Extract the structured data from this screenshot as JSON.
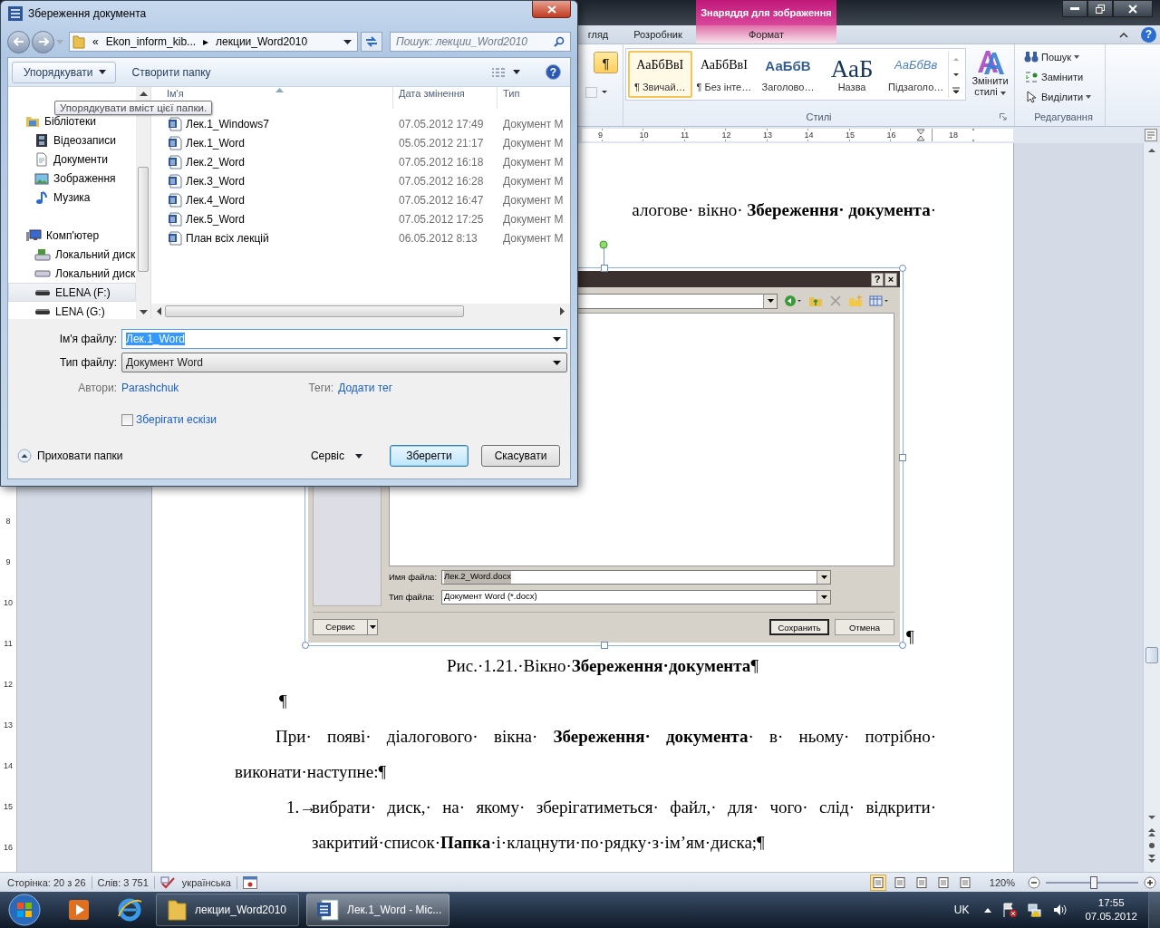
{
  "word": {
    "contextual_tab_group": "Знаряддя для зображення",
    "tabs": [
      {
        "label": "гляд",
        "selected": false,
        "contextual": false
      },
      {
        "label": "Розробник",
        "selected": false,
        "contextual": false
      },
      {
        "label": "Формат",
        "selected": false,
        "contextual": true
      }
    ],
    "ribbon": {
      "show_marks": {
        "label": "¶",
        "on": true
      },
      "styles": [
        {
          "sample": "АаБбВвІ",
          "name": "¶ Звичай…",
          "kind": "normal",
          "selected": true
        },
        {
          "sample": "АаБбВвІ",
          "name": "¶ Без інте…",
          "kind": "normal",
          "selected": false
        },
        {
          "sample": "АаБбВ",
          "name": "Заголово…",
          "kind": "heading",
          "selected": false
        },
        {
          "sample": "АаБ",
          "name": "Назва",
          "kind": "title",
          "selected": false
        },
        {
          "sample": "АаБбВв",
          "name": "Підзаголо…",
          "kind": "subtitle",
          "selected": false
        }
      ],
      "change_styles": "Змінити стилі",
      "styles_group": "Стилі",
      "editing": [
        {
          "label": "Пошук",
          "dropdown": true
        },
        {
          "label": "Замінити",
          "dropdown": false
        },
        {
          "label": "Виділити",
          "dropdown": true
        }
      ],
      "editing_group": "Редагування"
    },
    "help": "?",
    "ruler": {
      "numbers": [
        "9",
        "10",
        "11",
        "12",
        "13",
        "14",
        "15",
        "16"
      ],
      "after_marker": [
        "18"
      ]
    },
    "vertical_ruler": [
      "8",
      "9",
      "10",
      "11",
      "12",
      "13",
      "14",
      "15",
      "16"
    ],
    "document": {
      "first_line": "алогове· вікно· **Збереження· документа**·",
      "picture": {
        "file_name": {
          "label": "Имя файла:",
          "value": "Лек.2_Word.docx"
        },
        "file_type": {
          "label": "Тип файла:",
          "value": "Документ Word (*.docx)"
        },
        "title_buttons": [
          "?",
          "×"
        ],
        "tools": "Сервис",
        "buttons": [
          {
            "label": "Сохранить",
            "default": true
          },
          {
            "label": "Отмена",
            "default": false
          }
        ]
      },
      "picture_mark": "¶",
      "caption": "Рис.·1.21.·Вікно·**Збереження·документа**¶",
      "empty_paragraph": "¶",
      "paragraph": "При· появі· діалогового· вікна· **Збереження· документа**· в· ньому· потрібно· виконати·наступне:¶",
      "list": [
        {
          "number": "1.→",
          "text": "вибрати· диск,· на· якому· зберігатиметься· файл,· для· чого· слід· відкрити· закритий·список·**Папка**·і·клацнути·по·рядку·з·ім’ям·диска;¶"
        }
      ]
    },
    "status_bar": {
      "page": "Сторінка: 20 з 26",
      "words": "Слів: 3 751",
      "language": "українська",
      "views": [
        {
          "selected": true
        },
        {
          "selected": false
        },
        {
          "selected": false
        },
        {
          "selected": false
        },
        {
          "selected": false
        }
      ],
      "zoom": "120%",
      "zoom_slider": {
        "level": 0.52
      }
    }
  },
  "save_dialog": {
    "title": "Збереження документа",
    "address": {
      "overflow": "«",
      "parent": "Ekon_inform_kib...",
      "separator": "▸",
      "folder": "лекции_Word2010"
    },
    "search": {
      "placeholder": "Пошук: лекции_Word2010"
    },
    "toolbar": {
      "organize": "Упорядкувати",
      "new_folder": "Створити папку"
    },
    "tooltip": "Упорядкувати вміст цієї папки.",
    "nav": [
      {
        "label": "Бібліотеки",
        "selected": false,
        "children": [
          {
            "label": "Відеозаписи",
            "selected": false
          },
          {
            "label": "Документи",
            "selected": false
          },
          {
            "label": "Зображення",
            "selected": false
          },
          {
            "label": "Музика",
            "selected": false
          }
        ]
      },
      {
        "label": "Комп'ютер",
        "selected": false,
        "children": [
          {
            "label": "Локальний диск",
            "selected": false
          },
          {
            "label": "Локальний диск",
            "selected": false
          },
          {
            "label": "ELENA (F:)",
            "selected": true
          },
          {
            "label": "LENA (G:)",
            "selected": false
          }
        ]
      }
    ],
    "columns": [
      "Ім'я",
      "Дата змінення",
      "Тип"
    ],
    "files": [
      {
        "name": "Лек.1_Windows7",
        "date": "07.05.2012 17:49",
        "type": "Документ М"
      },
      {
        "name": "Лек.1_Word",
        "date": "05.05.2012 21:17",
        "type": "Документ М"
      },
      {
        "name": "Лек.2_Word",
        "date": "07.05.2012 16:18",
        "type": "Документ М"
      },
      {
        "name": "Лек.3_Word",
        "date": "07.05.2012 16:28",
        "type": "Документ М"
      },
      {
        "name": "Лек.4_Word",
        "date": "07.05.2012 16:47",
        "type": "Документ М"
      },
      {
        "name": "Лек.5_Word",
        "date": "07.05.2012 17:25",
        "type": "Документ М"
      },
      {
        "name": "План всіх лекцій",
        "date": "06.05.2012 8:13",
        "type": "Документ М"
      }
    ],
    "file_name": {
      "label": "Ім'я файлу:",
      "value": "Лек.1_Word"
    },
    "file_type": {
      "label": "Тип файлу:",
      "value": "Документ Word"
    },
    "authors": {
      "label": "Автори:",
      "value": "Parashchuk"
    },
    "tags": {
      "label": "Теги:",
      "value": "Додати тег"
    },
    "thumbnails": {
      "label": "Зберігати ескізи",
      "checked": false
    },
    "help": "?",
    "hide_folders": "Приховати папки",
    "tools": "Сервіс",
    "buttons": [
      {
        "label": "Зберегти",
        "default": true
      },
      {
        "label": "Скасувати",
        "default": false
      }
    ]
  },
  "taskbar": {
    "tasks": [
      {
        "label": "лекции_Word2010",
        "selected": false
      },
      {
        "label": "Лек.1_Word - Mic...",
        "selected": true
      }
    ],
    "language": "UK",
    "time": "17:55",
    "date": "07.05.2012"
  }
}
